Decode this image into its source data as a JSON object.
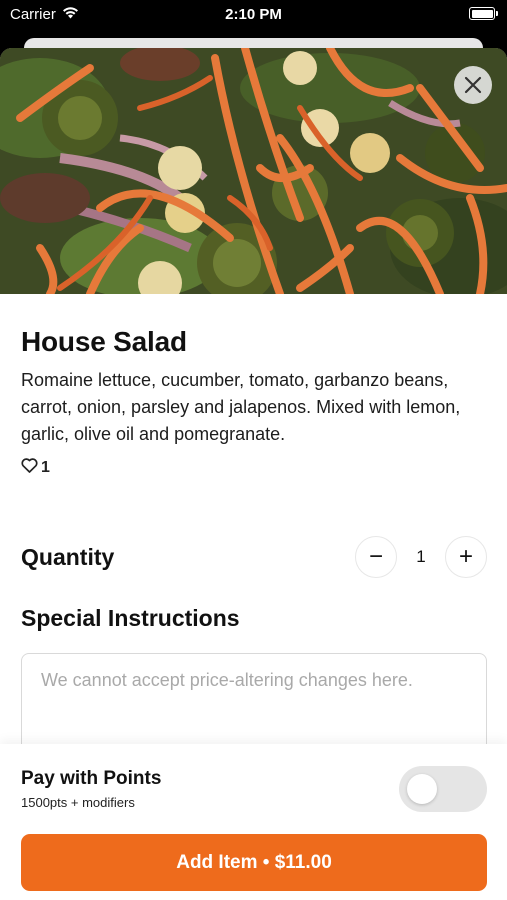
{
  "status_bar": {
    "carrier": "Carrier",
    "time": "2:10 PM"
  },
  "item": {
    "title": "House Salad",
    "description": "Romaine lettuce, cucumber, tomato, garbanzo beans, carrot, onion, parsley and jalapenos. Mixed with lemon, garlic, olive oil and pomegranate.",
    "likes": "1",
    "image_icon": "salad-photo"
  },
  "quantity": {
    "label": "Quantity",
    "value": "1",
    "minus": "−",
    "plus": "+"
  },
  "instructions": {
    "label": "Special Instructions",
    "placeholder": "We cannot accept price-altering changes here.",
    "value": ""
  },
  "points": {
    "title": "Pay with Points",
    "subtitle": "1500pts + modifiers",
    "enabled": false
  },
  "add_button": {
    "label": "Add Item • $11.00"
  },
  "colors": {
    "accent": "#ee6b1c",
    "toggle_off": "#e5e5e5"
  }
}
